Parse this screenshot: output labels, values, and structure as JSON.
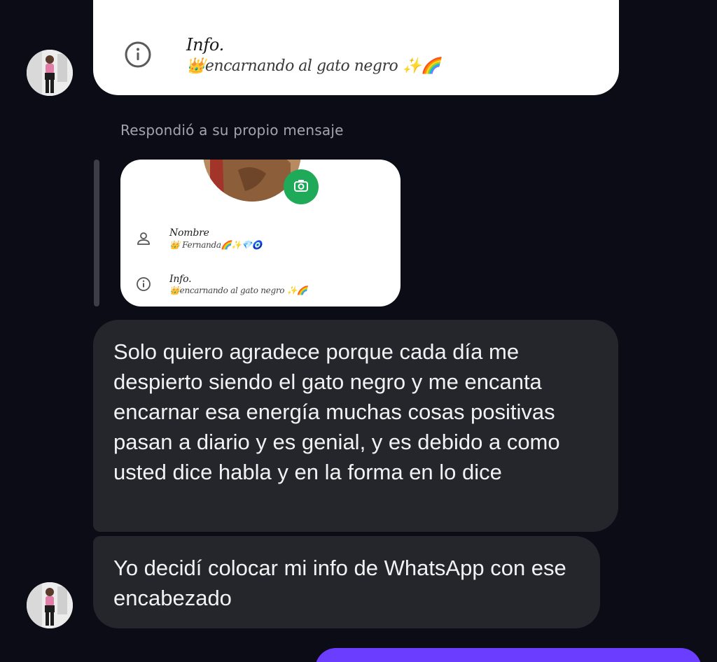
{
  "shared_card_top": {
    "info_title": "Info.",
    "info_value": "👑encarnando al gato negro ✨🌈"
  },
  "reply": {
    "label": "Respondió a su propio mensaje",
    "card": {
      "name_title": "Nombre",
      "name_value": "👑 Fernanda🌈✨💎🧿",
      "info_title": "Info.",
      "info_value": "👑encarnando al gato negro ✨🌈"
    }
  },
  "messages": [
    {
      "text": "Solo quiero agradece porque cada día me despierto siendo el gato negro y me encanta encarnar esa energía muchas cosas positivas pasan a diario y es genial, y es debido a como usted dice habla y en la forma en lo dice"
    },
    {
      "text": "Yo decidí colocar mi info de WhatsApp con ese encabezado"
    }
  ],
  "colors": {
    "background": "#0b0c16",
    "received_bubble": "#25262c",
    "sent_bubble": "#6b3dff",
    "camera_button": "#1faa59"
  },
  "icons": {
    "info": "info-icon",
    "person": "person-icon",
    "camera": "camera-icon"
  }
}
